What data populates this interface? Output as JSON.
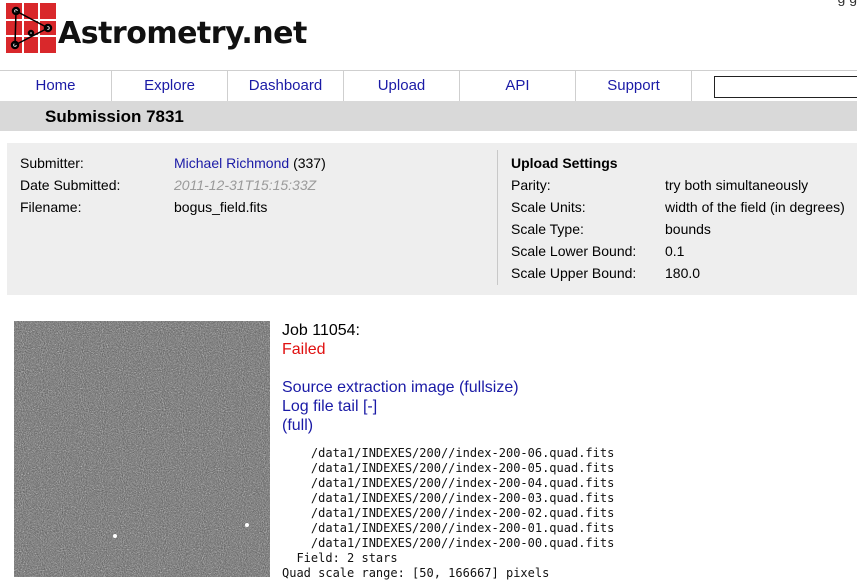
{
  "site": {
    "logo_text": "Astrometry.net",
    "top_right_fragment": "g     g"
  },
  "nav": {
    "items": [
      "Home",
      "Explore",
      "Dashboard",
      "Upload",
      "API",
      "Support"
    ],
    "search_value": ""
  },
  "page": {
    "title": "Submission 7831"
  },
  "submission": {
    "submitter_label": "Submitter:",
    "submitter_name": "Michael Richmond",
    "submitter_id": "(337)",
    "date_label": "Date Submitted:",
    "date_value": "2011-12-31T15:15:33Z",
    "filename_label": "Filename:",
    "filename_value": "bogus_field.fits"
  },
  "upload_settings": {
    "heading": "Upload Settings",
    "rows": [
      {
        "label": "Parity:",
        "value": "try both simultaneously"
      },
      {
        "label": "Scale Units:",
        "value": "width of the field (in degrees)"
      },
      {
        "label": "Scale Type:",
        "value": "bounds"
      },
      {
        "label": "Scale Lower Bound:",
        "value": "0.1"
      },
      {
        "label": "Scale Upper Bound:",
        "value": "180.0"
      }
    ]
  },
  "job": {
    "title": "Job 11054:",
    "status": "Failed",
    "status_color": "#e01010",
    "source_link": "Source extraction image (fullsize)",
    "log_tail_link": "Log file tail [-]",
    "log_full_link": "(full)",
    "log_lines": [
      "    /data1/INDEXES/200//index-200-06.quad.fits",
      "    /data1/INDEXES/200//index-200-05.quad.fits",
      "    /data1/INDEXES/200//index-200-04.quad.fits",
      "    /data1/INDEXES/200//index-200-03.quad.fits",
      "    /data1/INDEXES/200//index-200-02.quad.fits",
      "    /data1/INDEXES/200//index-200-01.quad.fits",
      "    /data1/INDEXES/200//index-200-00.quad.fits",
      "  Field: 2 stars",
      "Quad scale range: [50, 166667] pixels"
    ]
  },
  "colors": {
    "link": "#1a1aa6",
    "nav_border": "#cfcfcf",
    "subheader_bg": "#d9d9d9",
    "info_bg": "#eeeeee",
    "logo_red": "#d9282b"
  }
}
